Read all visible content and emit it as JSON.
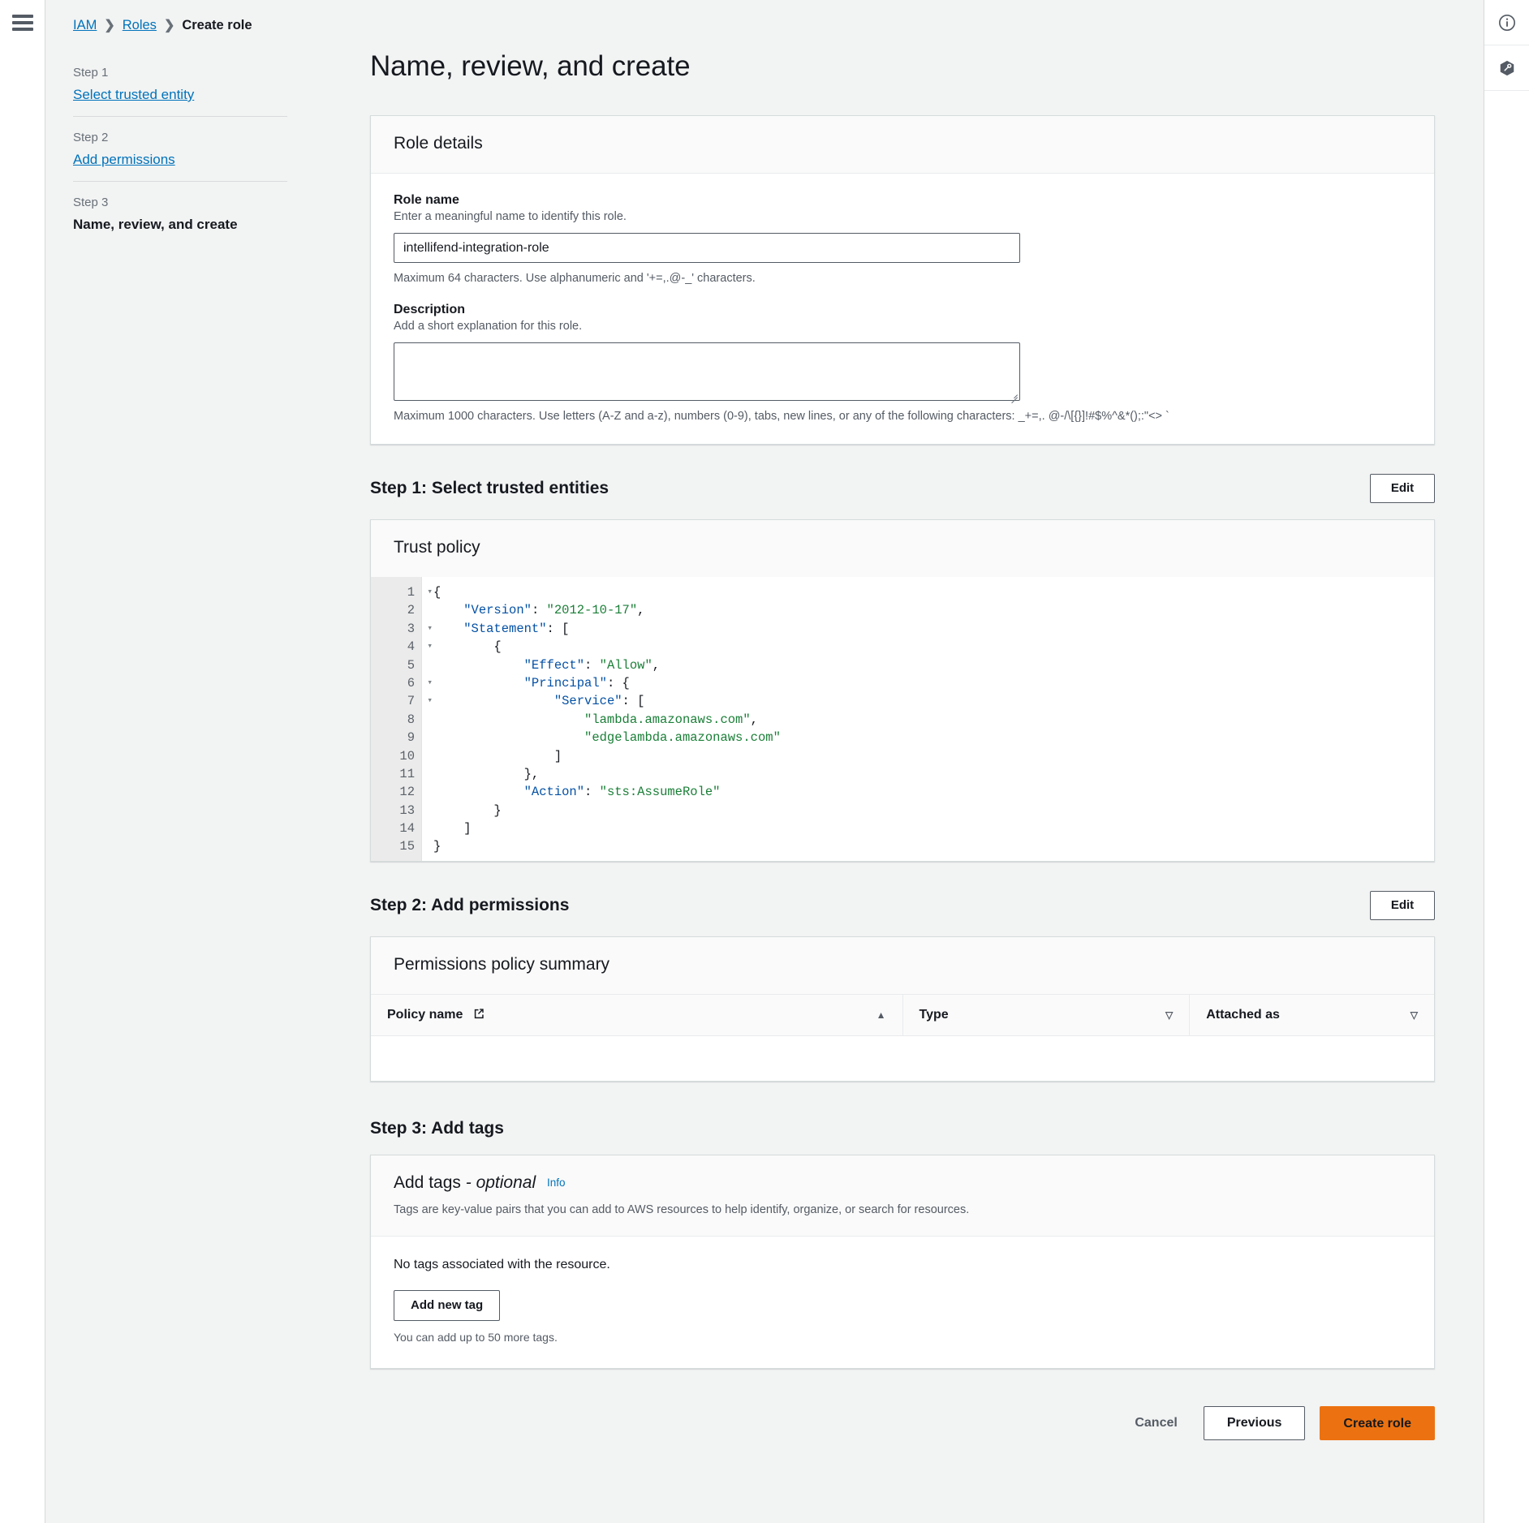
{
  "breadcrumb": {
    "items": [
      "IAM",
      "Roles",
      "Create role"
    ]
  },
  "sidebar": {
    "steps": [
      {
        "label": "Step 1",
        "name": "Select trusted entity",
        "current": false
      },
      {
        "label": "Step 2",
        "name": "Add permissions",
        "current": false
      },
      {
        "label": "Step 3",
        "name": "Name, review, and create",
        "current": true
      }
    ]
  },
  "page": {
    "title": "Name, review, and create"
  },
  "role_details": {
    "panel_title": "Role details",
    "role_name_label": "Role name",
    "role_name_desc": "Enter a meaningful name to identify this role.",
    "role_name_value": "intellifend-integration-role",
    "role_name_hint": "Maximum 64 characters. Use alphanumeric and '+=,.@-_' characters.",
    "description_label": "Description",
    "description_desc": "Add a short explanation for this role.",
    "description_value": "",
    "description_placeholder": "",
    "description_hint": "Maximum 1000 characters. Use letters (A-Z and a-z), numbers (0-9), tabs, new lines, or any of the following characters: _+=,. @-/\\[{}]!#$%^&*();:\"<> `"
  },
  "step1": {
    "heading": "Step 1: Select trusted entities",
    "edit_label": "Edit",
    "trust_policy_title": "Trust policy",
    "code_lines": [
      {
        "n": 1,
        "fold": true,
        "text": "{"
      },
      {
        "n": 2,
        "fold": false,
        "text": "    \"Version\": \"2012-10-17\","
      },
      {
        "n": 3,
        "fold": true,
        "text": "    \"Statement\": ["
      },
      {
        "n": 4,
        "fold": true,
        "text": "        {"
      },
      {
        "n": 5,
        "fold": false,
        "text": "            \"Effect\": \"Allow\","
      },
      {
        "n": 6,
        "fold": true,
        "text": "            \"Principal\": {"
      },
      {
        "n": 7,
        "fold": true,
        "text": "                \"Service\": ["
      },
      {
        "n": 8,
        "fold": false,
        "text": "                    \"lambda.amazonaws.com\","
      },
      {
        "n": 9,
        "fold": false,
        "text": "                    \"edgelambda.amazonaws.com\""
      },
      {
        "n": 10,
        "fold": false,
        "text": "                ]"
      },
      {
        "n": 11,
        "fold": false,
        "text": "            },"
      },
      {
        "n": 12,
        "fold": false,
        "text": "            \"Action\": \"sts:AssumeRole\""
      },
      {
        "n": 13,
        "fold": false,
        "text": "        }"
      },
      {
        "n": 14,
        "fold": false,
        "text": "    ]"
      },
      {
        "n": 15,
        "fold": false,
        "text": "}"
      }
    ]
  },
  "step2": {
    "heading": "Step 2: Add permissions",
    "edit_label": "Edit",
    "summary_title": "Permissions policy summary",
    "columns": [
      {
        "label": "Policy name",
        "sort": "asc",
        "has_external_icon": true
      },
      {
        "label": "Type",
        "sort": "none",
        "has_external_icon": false
      },
      {
        "label": "Attached as",
        "sort": "none",
        "has_external_icon": false
      }
    ],
    "rows": []
  },
  "step3": {
    "heading": "Step 3: Add tags",
    "panel_title": "Add tags",
    "panel_title_optional": "- optional",
    "info_label": "Info",
    "panel_sub": "Tags are key-value pairs that you can add to AWS resources to help identify, organize, or search for resources.",
    "empty_text": "No tags associated with the resource.",
    "add_tag_label": "Add new tag",
    "tag_hint": "You can add up to 50 more tags."
  },
  "footer": {
    "cancel_label": "Cancel",
    "previous_label": "Previous",
    "create_label": "Create role"
  },
  "colors": {
    "accent_orange": "#ec7211",
    "link_blue": "#0073bb",
    "bg": "#f2f3f3",
    "border": "#d5dbdb"
  }
}
